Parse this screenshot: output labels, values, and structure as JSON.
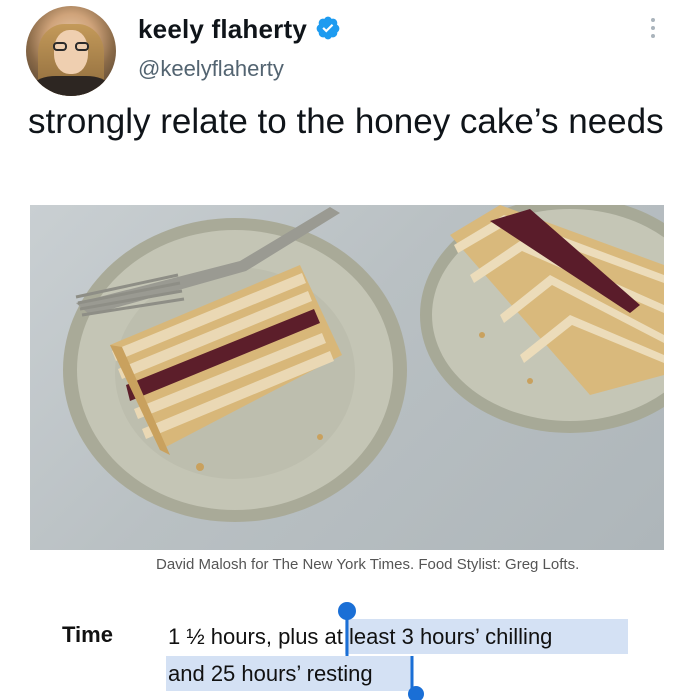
{
  "tweet": {
    "author_name": "keely flaherty",
    "author_handle": "@keelyflaherty",
    "text": "strongly relate to the honey cake’s needs",
    "colors": {
      "verified": "#1d9bf0",
      "handle": "#536471"
    }
  },
  "article": {
    "photo_credit": "David Malosh for The New York Times. Food Stylist: Greg Lofts.",
    "time_label": "Time",
    "time_line1_plain": "1 ½ hours, plus",
    "time_line1_selected": " at least 3 hours’ chilling",
    "time_line2_selected": "and 25 hours’ resting",
    "colors": {
      "selection": "#d4e1f4",
      "selection_handle": "#1a6fd6"
    }
  },
  "icons": {
    "verified": "verified-badge-icon",
    "more": "more-vertical-icon"
  }
}
